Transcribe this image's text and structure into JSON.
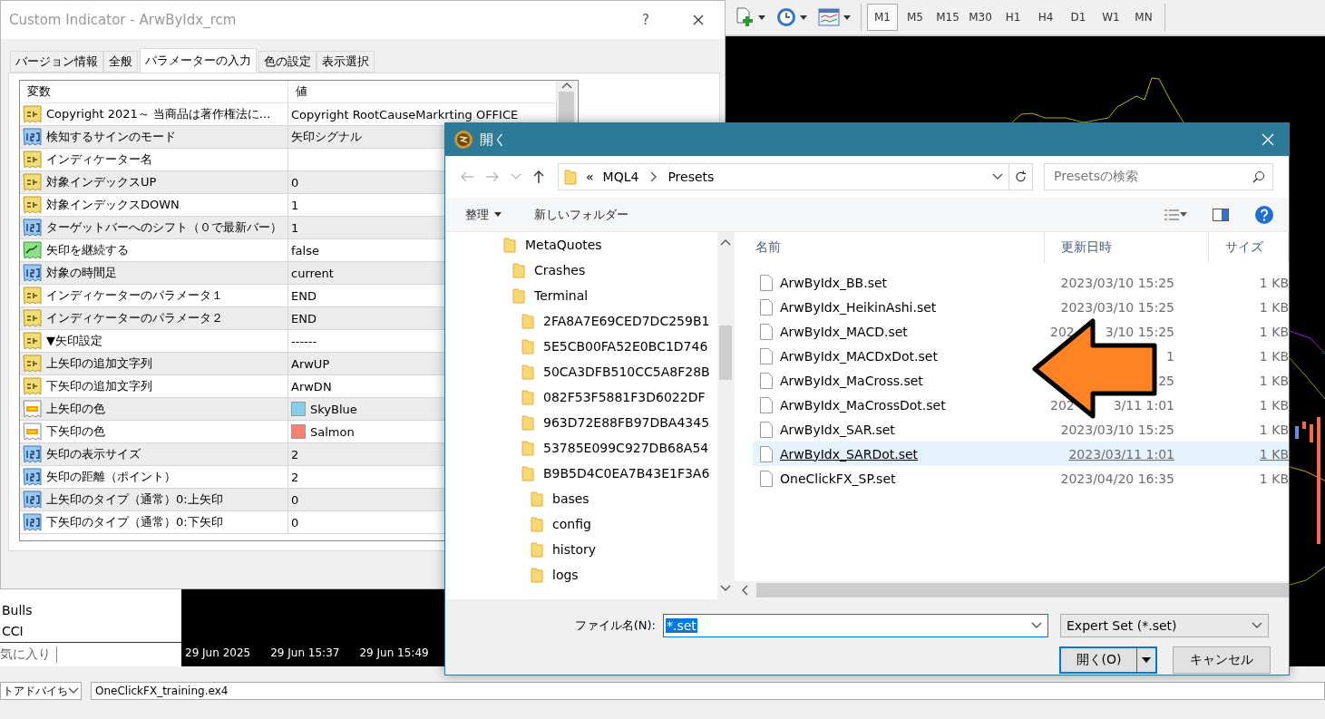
{
  "toolbar": {
    "timeframes": [
      {
        "label": "M1",
        "selected": true
      },
      {
        "label": "M5",
        "selected": false
      },
      {
        "label": "M15",
        "selected": false
      },
      {
        "label": "M30",
        "selected": false
      },
      {
        "label": "H1",
        "selected": false
      },
      {
        "label": "H4",
        "selected": false
      },
      {
        "label": "D1",
        "selected": false
      },
      {
        "label": "W1",
        "selected": false
      },
      {
        "label": "MN",
        "selected": false
      }
    ]
  },
  "navigator": {
    "items": [
      "Bulls",
      "CCI"
    ],
    "tab": "気に入り"
  },
  "chart": {
    "time_labels": [
      "29 Jun 2025",
      "29 Jun 15:37",
      "29 Jun 15:49"
    ]
  },
  "bottom_bar": {
    "dropdown": "トアドバイち",
    "field": "OneClickFX_training.ex4"
  },
  "indicator_dialog": {
    "title": "Custom Indicator - ArwByIdx_rcm",
    "help": "?",
    "tabs": [
      {
        "label": "バージョン情報",
        "selected": false
      },
      {
        "label": "全般",
        "selected": false
      },
      {
        "label": "パラメーターの入力",
        "selected": true
      },
      {
        "label": "色の設定",
        "selected": false
      },
      {
        "label": "表示選択",
        "selected": false
      }
    ],
    "columns": [
      "変数",
      "値"
    ],
    "rows": [
      {
        "kind": "text",
        "name": "Copyright 2021～ 当商品は著作権法に...",
        "value": "Copyright RootCauseMarkrting OFFICE"
      },
      {
        "kind": "number",
        "name": "検知するサインのモード",
        "value": "矢印シグナル"
      },
      {
        "kind": "text",
        "name": "インディケーター名"
      },
      {
        "kind": "text",
        "name": "対象インデックスUP",
        "value": "0"
      },
      {
        "kind": "text",
        "name": "対象インデックスDOWN",
        "value": "1"
      },
      {
        "kind": "number",
        "name": "ターゲットバーへのシフト（０で最新バー）",
        "value": "1"
      },
      {
        "kind": "bool",
        "name": "矢印を継続する",
        "value": "false"
      },
      {
        "kind": "number",
        "name": "対象の時間足",
        "value": "current"
      },
      {
        "kind": "text",
        "name": "インディケーターのパラメータ１",
        "value": "END"
      },
      {
        "kind": "text",
        "name": "インディケーターのパラメータ２",
        "value": "END"
      },
      {
        "kind": "text",
        "name": "▼矢印設定",
        "value": "------"
      },
      {
        "kind": "text",
        "name": "上矢印の追加文字列",
        "value": "ArwUP"
      },
      {
        "kind": "text",
        "name": "下矢印の追加文字列",
        "value": "ArwDN"
      },
      {
        "kind": "color",
        "name": "上矢印の色",
        "value": "SkyBlue",
        "color": "#87ceeb"
      },
      {
        "kind": "color",
        "name": "下矢印の色",
        "value": "Salmon",
        "color": "#fa8072"
      },
      {
        "kind": "number",
        "name": "矢印の表示サイズ",
        "value": "2"
      },
      {
        "kind": "number",
        "name": "矢印の距離（ポイント）",
        "value": "2"
      },
      {
        "kind": "number",
        "name": "上矢印のタイプ（通常）0:上矢印",
        "value": "0"
      },
      {
        "kind": "number",
        "name": "下矢印のタイプ（通常）0:下矢印",
        "value": "0"
      }
    ]
  },
  "open_dialog": {
    "title": "開く",
    "path": [
      "«",
      "MQL4",
      "Presets"
    ],
    "search_placeholder": "Presetsの検索",
    "organize": "整理",
    "new_folder": "新しいフォルダー",
    "tree": [
      {
        "label": "MetaQuotes",
        "children": [
          {
            "label": "Crashes"
          },
          {
            "label": "Terminal",
            "children": [
              {
                "label": "2FA8A7E69CED7DC259B1"
              },
              {
                "label": "5E5CB00FA52E0BC1D746"
              },
              {
                "label": "50CA3DFB510CC5A8F28B"
              },
              {
                "label": "082F53F5881F3D6022DF"
              },
              {
                "label": "963D72E88FB97DBA4345"
              },
              {
                "label": "53785E099C927DB68A54"
              },
              {
                "label": "B9B5D4C0EA7B43E1F3A6",
                "children": [
                  {
                    "label": "bases"
                  },
                  {
                    "label": "config"
                  },
                  {
                    "label": "history"
                  },
                  {
                    "label": "logs"
                  }
                ]
              }
            ]
          }
        ]
      }
    ],
    "columns": [
      "名前",
      "更新日時",
      "サイズ"
    ],
    "files": [
      {
        "name": "ArwByIdx_BB.set",
        "date": "2023/03/10 15:25",
        "size": "1 KB",
        "selected": false
      },
      {
        "name": "ArwByIdx_HeikinAshi.set",
        "date": "2023/03/10 15:25",
        "size": "1 KB",
        "selected": false
      },
      {
        "name": "ArwByIdx_MACD.set",
        "date_lead": "202",
        "date": "3/10 15:25",
        "size": "1 KB",
        "selected": false
      },
      {
        "name": "ArwByIdx_MACDxDot.set",
        "date": "1",
        "size": "1 KB",
        "selected": false
      },
      {
        "name": "ArwByIdx_MaCross.set",
        "date": "25",
        "size": "1 KB",
        "selected": false
      },
      {
        "name": "ArwByIdx_MaCrossDot.set",
        "date_lead": "202",
        "date": "3/11 1:01",
        "size": "1 KB",
        "selected": false
      },
      {
        "name": "ArwByIdx_SAR.set",
        "date": "2023/03/10 15:25",
        "size": "1 KB",
        "selected": false
      },
      {
        "name": "ArwByIdx_SARDot.set",
        "date": "2023/03/11 1:01",
        "size": "1 KB",
        "selected": true
      },
      {
        "name": "OneClickFX_SP.set",
        "date": "2023/04/20 16:35",
        "size": "1 KB",
        "selected": false
      }
    ],
    "filename_label": "ファイル名(N):",
    "filename": "*.set",
    "filter": "Expert Set (*.set)",
    "open_button": "開く(O)",
    "cancel_button": "キャンセル"
  }
}
